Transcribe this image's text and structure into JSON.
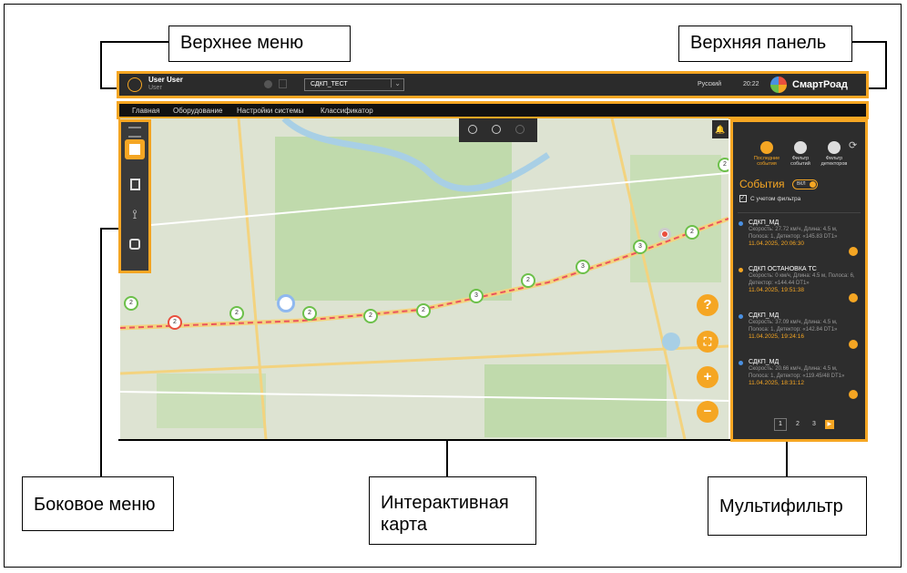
{
  "callouts": {
    "top_menu": "Верхнее меню",
    "top_panel": "Верхняя панель",
    "side_menu": "Боковое меню",
    "interactive_map": "Интерактивная карта",
    "multifilter": "Мультифильтр"
  },
  "topbar": {
    "user_name": "User User",
    "user_role": "User",
    "dropdown_value": "СДКП_ТЕСТ",
    "language": "Русский",
    "time": "20:22",
    "brand": "СмартРоад"
  },
  "menu": {
    "items": [
      "Главная",
      "Оборудование",
      "Настройки системы",
      "Классификатор"
    ]
  },
  "panel": {
    "tabs": [
      "Последние события",
      "Фильтр событий",
      "Фильтр детекторов"
    ],
    "events_title": "События",
    "toggle_label": "ВКЛ",
    "filter_checkbox": "С учетом фильтра",
    "events": [
      {
        "title": "СДКП_МД",
        "details": "Скорость: 27.72 км/ч, Длина: 4.5 м, Полоса: 1, Детектор: «145.83 DT1»",
        "time": "11.04.2025, 20:06:30",
        "color": "#4a90e2"
      },
      {
        "title": "СДКП ОСТАНОВКА ТС",
        "details": "Скорость: 0 км/ч, Длина: 4.5 м, Полоса: 6, Детектор: «144.44 DT1»",
        "time": "11.04.2025, 19:51:38",
        "color": "#f5a623"
      },
      {
        "title": "СДКП_МД",
        "details": "Скорость: 37.09 км/ч, Длина: 4.5 м, Полоса: 1, Детектор: «142.84 DT1»",
        "time": "11.04.2025, 19:24:16",
        "color": "#4a90e2"
      },
      {
        "title": "СДКП_МД",
        "details": "Скорость: 20.66 км/ч, Длина: 4.5 м, Полоса: 1, Детектор: «119.45/48 DT1»",
        "time": "11.04.2025, 18:31:12",
        "color": "#4a90e2"
      }
    ],
    "pages": [
      "1",
      "2",
      "3"
    ]
  },
  "map": {
    "pins": [
      "2",
      "2",
      "2",
      "2",
      "2",
      "2",
      "3",
      "2",
      "3",
      "2",
      "2",
      "3",
      "3",
      "2"
    ],
    "fab_buttons": [
      "?",
      "⛶",
      "+",
      "−"
    ]
  },
  "colors": {
    "accent": "#f5a623",
    "green": "#6cc04a"
  }
}
